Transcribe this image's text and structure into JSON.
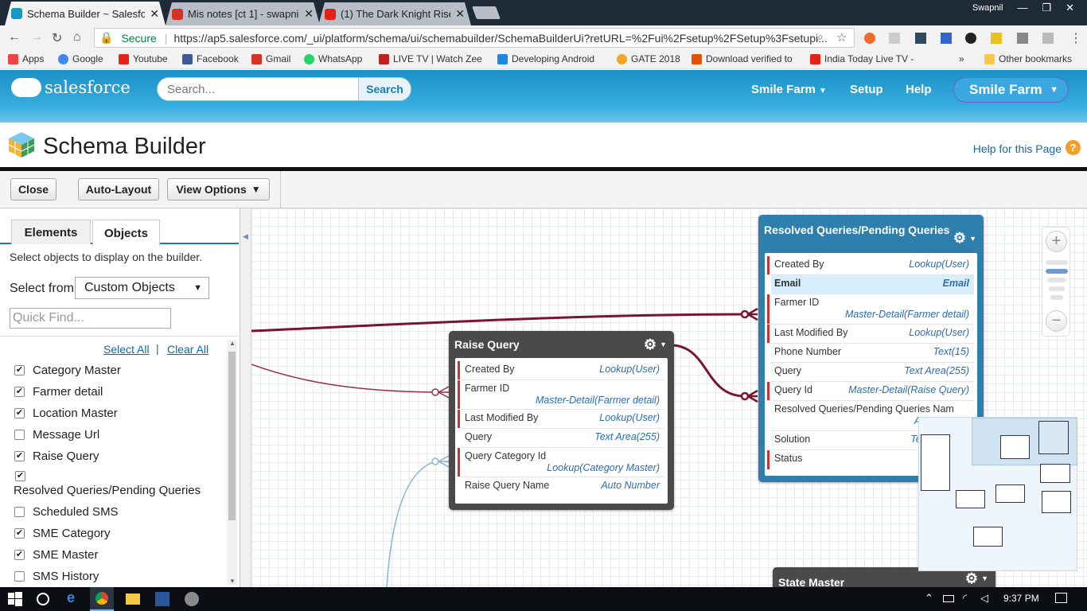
{
  "browser": {
    "tabs": [
      {
        "title": "Schema Builder ~ Salesfo",
        "color": "#1798c1"
      },
      {
        "title": "Mis notes [ct 1] - swapnil",
        "color": "#d93025"
      },
      {
        "title": "(1) The Dark Knight Rises",
        "color": "#e62117"
      }
    ],
    "user": "Swapnil",
    "url": "https://ap5.salesforce.com/_ui/platform/schema/ui/schemabuilder/SchemaBuilderUi?retURL=%2Fui%2Fsetup%2FSetup%3Fsetupi...",
    "secure_label": "Secure",
    "bookmarks": [
      "Apps",
      "Google",
      "Youtube",
      "Facebook",
      "Gmail",
      "WhatsApp",
      "LIVE TV | Watch Zee",
      "Developing Android",
      "GATE 2018",
      "Download verified to",
      "India Today Live TV -"
    ],
    "bookmarks_overflow": "»",
    "other_bookmarks": "Other bookmarks"
  },
  "salesforce": {
    "logo_text": "salesforce",
    "search_placeholder": "Search...",
    "search_button": "Search",
    "nav": {
      "org_menu": "Smile Farm",
      "setup": "Setup",
      "help": "Help"
    },
    "app_button": "Smile Farm",
    "page_title": "Schema Builder",
    "help_link": "Help for this Page",
    "help_icon": "?"
  },
  "toolbar": {
    "close": "Close",
    "auto_layout": "Auto-Layout",
    "view_options": "View Options"
  },
  "sidebar": {
    "tabs": [
      "Elements",
      "Objects"
    ],
    "active_tab": "Objects",
    "hint": "Select objects to display on the builder.",
    "select_from_label": "Select from",
    "select_value": "Custom Objects",
    "quick_find_placeholder": "Quick Find...",
    "select_all": "Select All",
    "separator": "|",
    "clear_all": "Clear All",
    "objects": [
      {
        "label": "Category Master",
        "checked": true
      },
      {
        "label": "Farmer detail",
        "checked": true
      },
      {
        "label": "Location Master",
        "checked": true
      },
      {
        "label": "Message Url",
        "checked": false
      },
      {
        "label": "Raise Query",
        "checked": true
      },
      {
        "label": "Resolved Queries/Pending Queries",
        "checked": true
      },
      {
        "label": "Scheduled SMS",
        "checked": false
      },
      {
        "label": "SME Category",
        "checked": true
      },
      {
        "label": "SME Master",
        "checked": true
      },
      {
        "label": "SMS History",
        "checked": false
      }
    ]
  },
  "canvas": {
    "raise_query": {
      "title": "Raise Query",
      "fields": [
        {
          "name": "Created By",
          "type": "Lookup(User)",
          "required": true
        },
        {
          "name": "Farmer ID",
          "type": "Master-Detail(Farmer detail)",
          "required": true
        },
        {
          "name": "Last Modified By",
          "type": "Lookup(User)",
          "required": true
        },
        {
          "name": "Query",
          "type": "Text Area(255)",
          "required": false
        },
        {
          "name": "Query Category Id",
          "type": "Lookup(Category Master)",
          "required": true
        },
        {
          "name": "Raise Query Name",
          "type": "Auto Number",
          "required": false
        }
      ]
    },
    "resolved": {
      "title": "Resolved Queries/Pending Queries",
      "fields": [
        {
          "name": "Created By",
          "type": "Lookup(User)",
          "required": true
        },
        {
          "name": "Email",
          "type": "Email",
          "required": false
        },
        {
          "name": "Farmer ID",
          "type": "Master-Detail(Farmer detail)",
          "required": true
        },
        {
          "name": "Last Modified By",
          "type": "Lookup(User)",
          "required": true
        },
        {
          "name": "Phone Number",
          "type": "Text(15)",
          "required": false
        },
        {
          "name": "Query",
          "type": "Text Area(255)",
          "required": false
        },
        {
          "name": "Query Id",
          "type": "Master-Detail(Raise Query)",
          "required": true
        },
        {
          "name": "Resolved Queries/Pending Queries Nam",
          "type": "Au",
          "required": false
        },
        {
          "name": "Solution",
          "type": "Tex",
          "required": false
        },
        {
          "name": "Status",
          "type": "",
          "required": true
        }
      ]
    },
    "state_master": {
      "title": "State Master"
    }
  },
  "taskbar": {
    "time": "9:37 PM"
  }
}
